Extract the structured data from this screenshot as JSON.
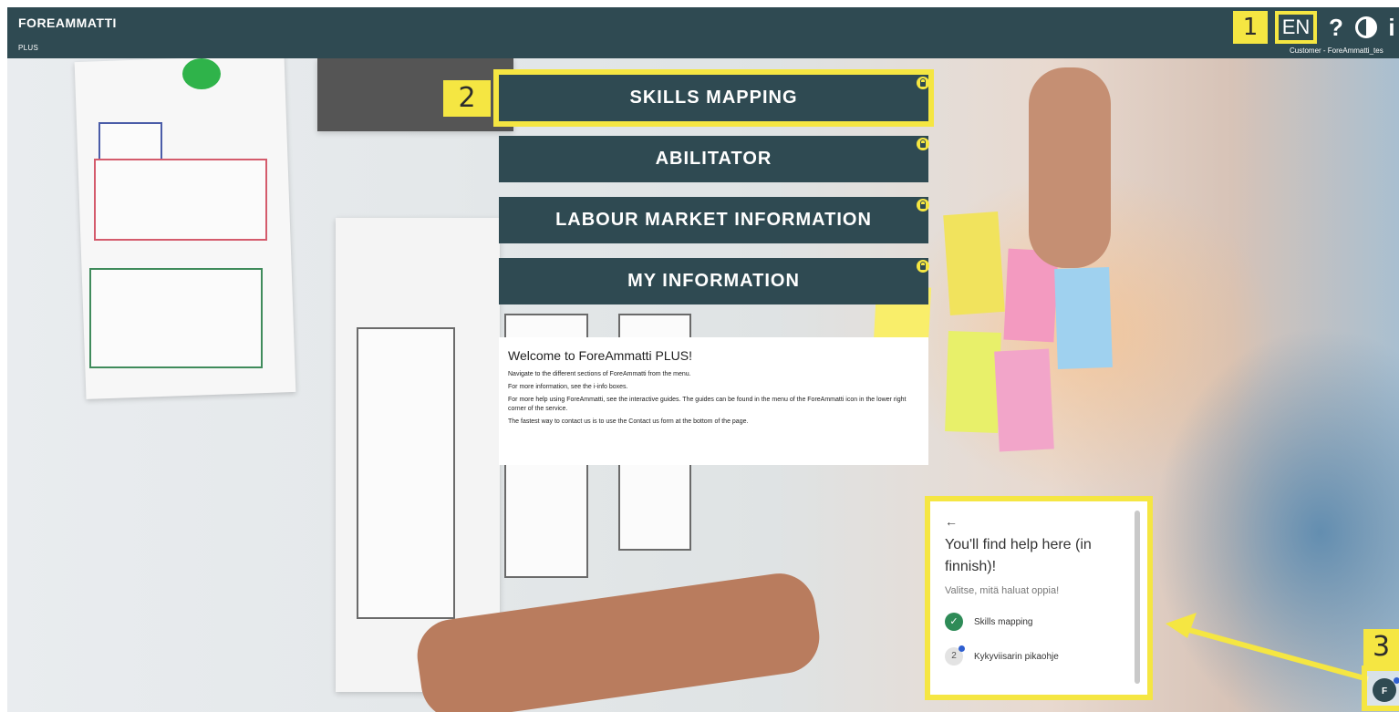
{
  "header": {
    "brand": "FOREAMMATTI",
    "brand_sub": "PLUS",
    "marker_1": "1",
    "language": "EN",
    "help_icon": "question-icon",
    "contrast_icon": "contrast-icon",
    "info_icon": "info-icon",
    "customer_text": "Customer - ForeAmmatti_tes"
  },
  "menu": {
    "marker_2": "2",
    "items": [
      {
        "label": "SKILLS MAPPING",
        "locked": true
      },
      {
        "label": "ABILITATOR",
        "locked": true
      },
      {
        "label": "LABOUR MARKET INFORMATION",
        "locked": true
      },
      {
        "label": "MY INFORMATION",
        "locked": true
      }
    ]
  },
  "welcome": {
    "title": "Welcome to ForeAmmatti PLUS!",
    "paragraphs": [
      "Navigate to the different sections of ForeAmmatti from the menu.",
      "For more information, see the i-info boxes.",
      "For more help using ForeAmmatti, see the interactive guides. The guides can be found in the menu of the ForeAmmatti icon in the lower right corner of the service.",
      "The fastest way to contact us is to use the Contact us form at the bottom of the page."
    ]
  },
  "help_panel": {
    "back": "←",
    "title": "You'll find help here (in finnish)!",
    "subtitle": "Valitse, mitä haluat oppia!",
    "items": [
      {
        "label": "Skills mapping",
        "status": "done"
      },
      {
        "number": "2",
        "label": "Kykyviisarin pikaohje",
        "status": "pending"
      }
    ]
  },
  "assistant": {
    "marker_3": "3",
    "icon": "foreammatti-assistant-icon",
    "icon_letter": "F"
  },
  "colors": {
    "header_bg": "#2f4a52",
    "highlight": "#f5e642",
    "check_green": "#2e8b57",
    "notification_blue": "#2f5fd0"
  }
}
